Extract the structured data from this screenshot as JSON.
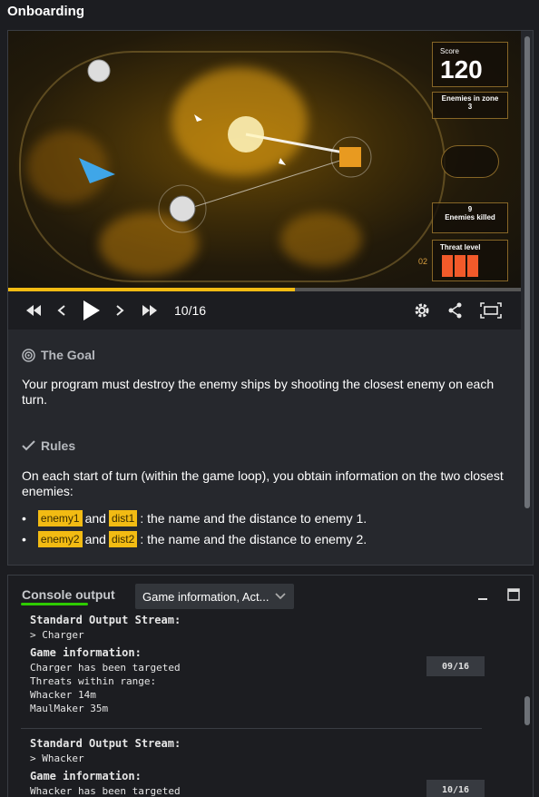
{
  "window": {
    "title": "Onboarding"
  },
  "game": {
    "hud": {
      "score_label": "Score",
      "score_value": "120",
      "enemies_in_zone_label": "Enemies in zone",
      "enemies_in_zone_value": "3",
      "enemies_killed_label": "Enemies killed",
      "enemies_killed_value": "9",
      "threat_label": "Threat level",
      "threat_value": "02"
    },
    "progress_fraction": 0.56
  },
  "player": {
    "counter": "10/16",
    "icons": [
      "rewind-icon",
      "step-back-icon",
      "play-icon",
      "step-forward-icon",
      "fast-forward-icon",
      "settings-icon",
      "share-icon",
      "fullscreen-icon"
    ]
  },
  "statement": {
    "goal_heading": "The Goal",
    "goal_text": "Your program must destroy the enemy ships by shooting the closest enemy on each turn.",
    "rules_heading": "Rules",
    "rules_text": "On each start of turn (within the game loop), you obtain information on the two closest enemies:",
    "bullets": [
      {
        "var_a": "enemy1",
        "and": "and",
        "var_b": "dist1",
        "text": ": the name and the distance to enemy 1."
      },
      {
        "var_a": "enemy2",
        "and": "and",
        "var_b": "dist2",
        "text": ": the name and the distance to enemy 2."
      }
    ]
  },
  "console": {
    "tab_label": "Console output",
    "dropdown_value": "Game information, Act...",
    "entries": [
      {
        "stdout_heading": "Standard Output Stream:",
        "stdout_line": "> Charger",
        "info_heading": "Game information:",
        "info_lines": [
          "Charger has been targeted",
          "Threats within range:",
          "Whacker 14m",
          "MaulMaker 35m"
        ],
        "turn": "09/16"
      },
      {
        "stdout_heading": "Standard Output Stream:",
        "stdout_line": "> Whacker",
        "info_heading": "Game information:",
        "info_lines": [
          "Whacker has been targeted"
        ],
        "turn": "10/16"
      }
    ]
  },
  "colors": {
    "accent": "#f2bb13",
    "tab_underline": "#2ecb00",
    "threat": "#f25a2a"
  }
}
